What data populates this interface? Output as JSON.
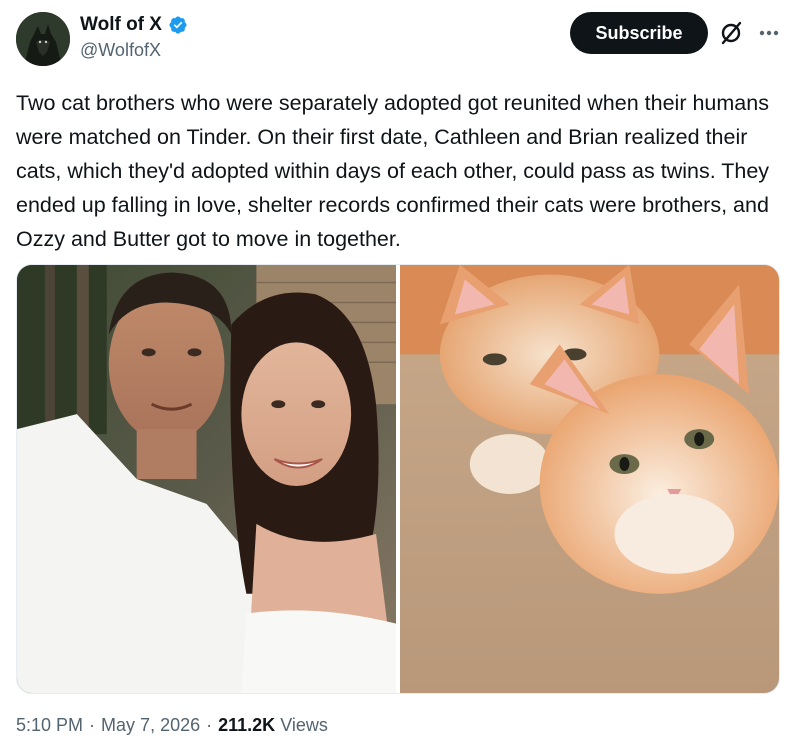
{
  "author": {
    "display_name": "Wolf of X",
    "handle": "@WolfofX",
    "verified_color": "#1d9bf0"
  },
  "actions": {
    "subscribe_label": "Subscribe",
    "grok_icon": "grok-icon",
    "more_icon": "more-dots-icon"
  },
  "tweet": {
    "text": "Two cat brothers who were separately adopted got reunited when their humans were matched on Tinder. On their first date, Cathleen and Brian realized their cats, which they'd adopted within days of each other, could pass as twins. They ended up falling in love, shelter records confirmed their cats were brothers, and Ozzy and Butter got to move in together."
  },
  "media": [
    {
      "kind": "photo",
      "subject": "couple-selfie"
    },
    {
      "kind": "photo",
      "subject": "two-orange-kittens"
    }
  ],
  "meta": {
    "time": "5:10 PM",
    "separator": "·",
    "date": "May 7, 2026",
    "views_count": "211.2K",
    "views_label": "Views"
  }
}
